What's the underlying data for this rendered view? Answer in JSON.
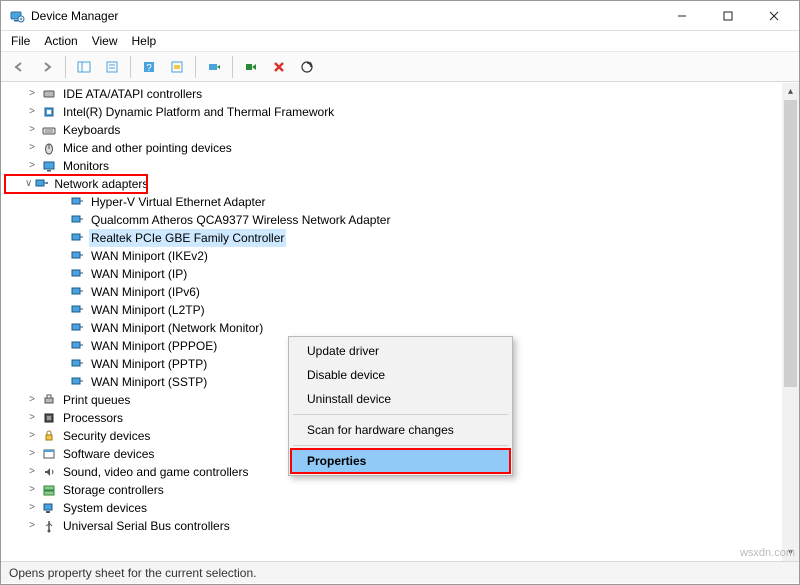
{
  "window": {
    "title": "Device Manager"
  },
  "menu": {
    "file": "File",
    "action": "Action",
    "view": "View",
    "help": "Help"
  },
  "tree": {
    "items": [
      {
        "label": "IDE ATA/ATAPI controllers",
        "icon": "ide-icon"
      },
      {
        "label": "Intel(R) Dynamic Platform and Thermal Framework",
        "icon": "chip-icon"
      },
      {
        "label": "Keyboards",
        "icon": "keyboard-icon"
      },
      {
        "label": "Mice and other pointing devices",
        "icon": "mouse-icon"
      },
      {
        "label": "Monitors",
        "icon": "monitor-icon"
      },
      {
        "label": "Network adapters",
        "icon": "network-icon",
        "expanded": true,
        "highlighted": true,
        "children": [
          {
            "label": "Hyper-V Virtual Ethernet Adapter"
          },
          {
            "label": "Qualcomm Atheros QCA9377 Wireless Network Adapter"
          },
          {
            "label": "Realtek PCIe GBE Family Controller",
            "selected": true
          },
          {
            "label": "WAN Miniport (IKEv2)"
          },
          {
            "label": "WAN Miniport (IP)"
          },
          {
            "label": "WAN Miniport (IPv6)"
          },
          {
            "label": "WAN Miniport (L2TP)"
          },
          {
            "label": "WAN Miniport (Network Monitor)"
          },
          {
            "label": "WAN Miniport (PPPOE)"
          },
          {
            "label": "WAN Miniport (PPTP)"
          },
          {
            "label": "WAN Miniport (SSTP)"
          }
        ]
      },
      {
        "label": "Print queues",
        "icon": "printer-icon"
      },
      {
        "label": "Processors",
        "icon": "cpu-icon"
      },
      {
        "label": "Security devices",
        "icon": "security-icon"
      },
      {
        "label": "Software devices",
        "icon": "software-icon"
      },
      {
        "label": "Sound, video and game controllers",
        "icon": "sound-icon"
      },
      {
        "label": "Storage controllers",
        "icon": "storage-icon"
      },
      {
        "label": "System devices",
        "icon": "system-icon"
      },
      {
        "label": "Universal Serial Bus controllers",
        "icon": "usb-icon"
      }
    ]
  },
  "context_menu": {
    "update": "Update driver",
    "disable": "Disable device",
    "uninstall": "Uninstall device",
    "scan": "Scan for hardware changes",
    "properties": "Properties"
  },
  "statusbar": "Opens property sheet for the current selection.",
  "watermark": "wsxdn.com"
}
